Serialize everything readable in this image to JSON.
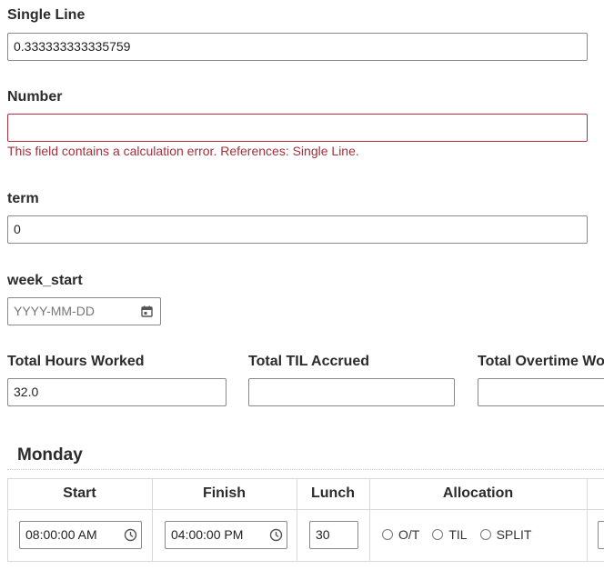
{
  "fields": {
    "single_line": {
      "label": "Single Line",
      "value": "0.333333333335759"
    },
    "number": {
      "label": "Number",
      "value": "",
      "error": "This field contains a calculation error. References: Single Line."
    },
    "term": {
      "label": "term",
      "value": "0"
    },
    "week_start": {
      "label": "week_start",
      "placeholder": "YYYY-MM-DD"
    },
    "total_hours": {
      "label": "Total Hours Worked",
      "value": "32.0"
    },
    "total_til": {
      "label": "Total TIL Accrued",
      "value": ""
    },
    "total_overtime": {
      "label": "Total Overtime Wo",
      "value": ""
    }
  },
  "monday": {
    "title": "Monday",
    "columns": [
      "Start",
      "Finish",
      "Lunch",
      "Allocation"
    ],
    "start": "08:00:00 AM",
    "finish": "04:00:00 PM",
    "lunch": "30",
    "allocation_options": [
      "O/T",
      "TIL",
      "SPLIT"
    ]
  },
  "colors": {
    "error": "#a3303c",
    "border": "#8a8a8a"
  },
  "icons": {
    "date": "calendar-icon",
    "time": "clock-icon"
  }
}
